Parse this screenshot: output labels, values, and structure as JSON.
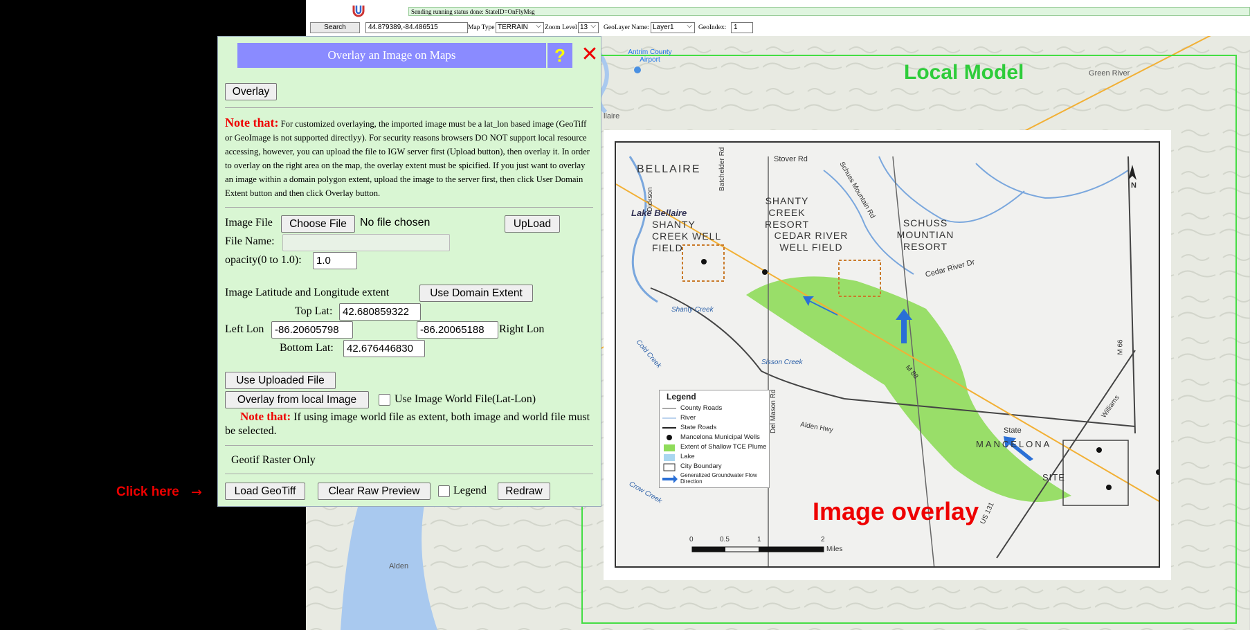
{
  "toolbar": {
    "status_text": "Sending running status done: StateID=OnFlyMsg",
    "search_label": "Search",
    "coords_value": "44.879389,-84.486515",
    "map_type_label": "Map Type",
    "map_type_value": "TERRAIN",
    "zoom_label": "Zoom Level",
    "zoom_value": "13",
    "geolayer_label": "GeoLayer Name:",
    "geolayer_value": "Layer1",
    "geoindex_label": "GeoIndex:",
    "geoindex_value": "1"
  },
  "panel": {
    "title": "Overlay an Image on Maps",
    "help": "?",
    "close": "✕",
    "overlay_button": "Overlay",
    "note1_prefix": "Note that:",
    "note1_text": "For customized overlaying, the imported image must be a lat_lon based image (GeoTiff or GeoImage is not supported directlyy). For security reasons browsers DO NOT support local resource accessing, however, you can upload the file to IGW server first (Upload button), then overlay it. In order to overlay on the right area on the map, the overlay extent must be spicified. If you just want to overlay an image within a domain polygon extent, upload the image to the server first, then click User Domain Extent button and then click Overlay button.",
    "image_file_label": "Image File",
    "choose_file_button": "Choose File",
    "no_file_text": "No file chosen",
    "upload_button": "UpLoad",
    "file_name_label": "File Name:",
    "file_name_value": "",
    "opacity_label": "opacity(0 to 1.0):",
    "opacity_value": "1.0",
    "extent_label": "Image Latitude and Longitude extent",
    "use_domain_extent_button": "Use Domain Extent",
    "top_lat_label": "Top Lat:",
    "top_lat_value": "42.680859322",
    "left_lon_label": "Left Lon",
    "left_lon_value": "-86.20605798",
    "right_lon_value": "-86.20065188",
    "right_lon_label": "Right Lon",
    "bottom_lat_label": "Bottom Lat:",
    "bottom_lat_value": "42.676446830",
    "use_uploaded_file_button": "Use Uploaded File",
    "overlay_local_button": "Overlay from local Image",
    "world_file_label": "Use Image World File(Lat-Lon)",
    "note2_prefix": "Note that:",
    "note2_text": "If using image world file as extent, both image and world file must be selected.",
    "geotif_label": "Geotif Raster Only",
    "load_geotiff_button": "Load GeoTiff",
    "clear_preview_button": "Clear Raw Preview",
    "legend_label": "Legend",
    "redraw_button": "Redraw"
  },
  "map": {
    "labels": {
      "antrim": "Antrim County Airport",
      "green_river": "Green River",
      "bellaire_side": "llaire",
      "alden": "Alden"
    }
  },
  "overlay_image": {
    "bellaire": "BELLAIRE",
    "lake_bellaire": "Lake Bellaire",
    "shanty_creek_well": "SHANTY CREEK WELL FIELD",
    "shanty_creek_resort": "SHANTY CREEK RESORT",
    "cedar_river_well": "CEDAR RIVER WELL FIELD",
    "schuss": "SCHUSS MOUNTIAN RESORT",
    "stover_rd": "Stover Rd",
    "batchelder_rd": "Batchelder Rd",
    "dickson": "Dickson",
    "schuss_mountain_rd": "Schuss Mountain Rd",
    "cedar_river_dr": "Cedar River Dr",
    "shanty_creek": "Shanty Creek",
    "cold_creek": "Cold Creek",
    "sisson_creek": "Sisson Creek",
    "m88": "M 88",
    "m66": "M 66",
    "del_mason": "Del Mason Rd",
    "alden_hwy": "Alden Hwy",
    "mancelona": "MANCELONA",
    "state": "State",
    "williams": "Williams",
    "site": "SITE",
    "us131": "US 131",
    "crow_creek": "Crow Creek",
    "north": "N",
    "scale_0": "0",
    "scale_05": "0.5",
    "scale_1": "1",
    "scale_2": "2",
    "scale_miles": "Miles",
    "legend_title": "Legend",
    "legend_items": [
      "County Roads",
      "River",
      "State Roads",
      "Mancelona Municipal Wells",
      "Extent of Shallow TCE Plume",
      "Lake",
      "City Boundary",
      "Generalized Groundwater Flow Direction"
    ]
  },
  "annotations": {
    "local_model": "Local Model",
    "image_overlay": "Image overlay",
    "click_here": "Click here"
  },
  "colors": {
    "panel_bg": "#d9f6d3",
    "title_bg": "#8a8bff",
    "alert_red": "#e00000",
    "local_model_green": "#2ecc3a",
    "plume_green": "#8fdc5a"
  }
}
